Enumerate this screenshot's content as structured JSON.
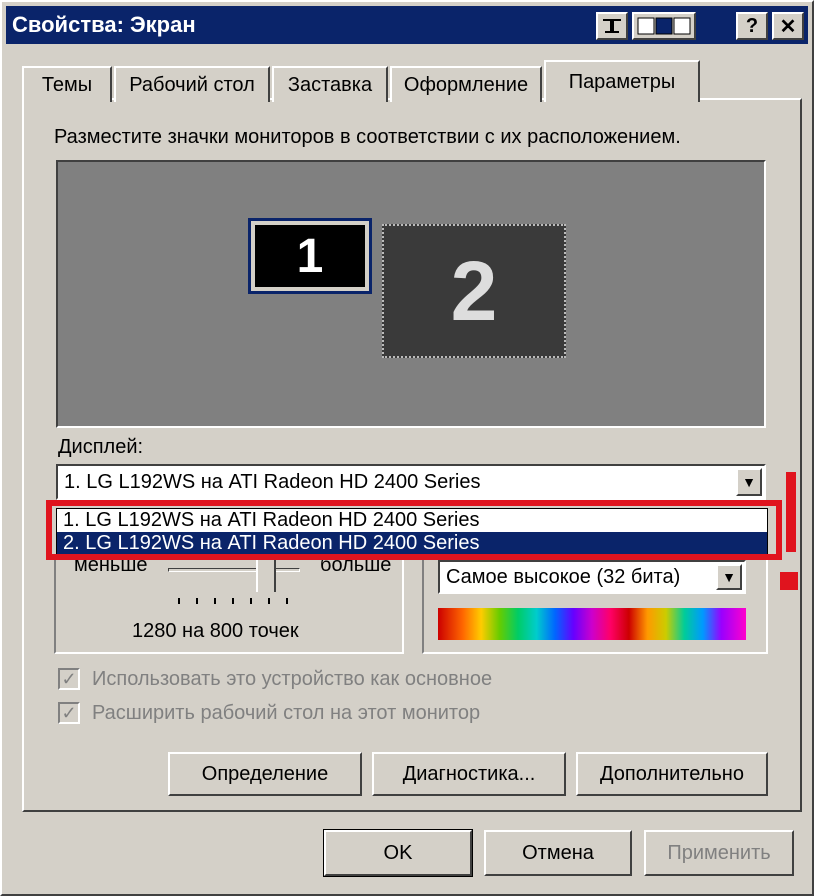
{
  "window": {
    "title": "Свойства: Экран"
  },
  "titlebar_buttons": {
    "help": "?",
    "close": "✕"
  },
  "tabs": [
    {
      "label": "Темы"
    },
    {
      "label": "Рабочий стол"
    },
    {
      "label": "Заставка"
    },
    {
      "label": "Оформление"
    },
    {
      "label": "Параметры"
    }
  ],
  "instruction": "Разместите значки мониторов в соответствии с их расположением.",
  "monitors": {
    "m1": "1",
    "m2": "2"
  },
  "display": {
    "label": "Дисплей:",
    "selected": "1. LG L192WS на ATI Radeon HD 2400 Series",
    "options": [
      "1. LG L192WS на ATI Radeon HD 2400 Series",
      "2. LG L192WS на ATI Radeon HD 2400 Series"
    ]
  },
  "resolution": {
    "less": "меньше",
    "more": "больше",
    "value": "1280 на 800 точек"
  },
  "color_quality": {
    "selected": "Самое высокое (32 бита)"
  },
  "checkboxes": {
    "primary": "Использовать это устройство как основное",
    "extend": "Расширить рабочий стол на этот монитор"
  },
  "buttons": {
    "identify": "Определение",
    "troubleshoot": "Диагностика...",
    "advanced": "Дополнительно",
    "ok": "OK",
    "cancel": "Отмена",
    "apply": "Применить"
  },
  "colors": {
    "titlebar": "#0a246a",
    "highlight": "#e0141e",
    "selection": "#0a246a"
  }
}
